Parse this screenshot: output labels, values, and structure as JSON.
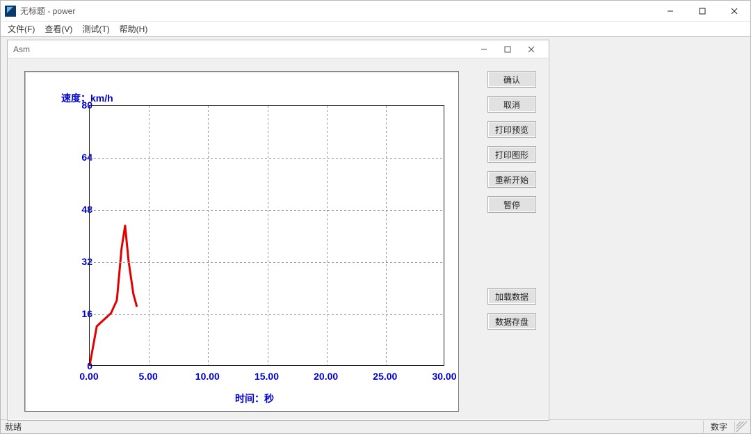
{
  "outer": {
    "title": "无标题 - power",
    "menu": {
      "file": "文件(F)",
      "view": "查看(V)",
      "test": "测试(T)",
      "help": "帮助(H)"
    }
  },
  "inner": {
    "title": "Asm"
  },
  "buttons": {
    "ok": "确认",
    "cancel": "取消",
    "print_preview": "打印预览",
    "print_graph": "打印图形",
    "restart": "重新开始",
    "pause": "暂停",
    "load_data": "加载数据",
    "save_data": "数据存盘"
  },
  "status": {
    "ready": "就绪",
    "num": "数字"
  },
  "chart_data": {
    "type": "line",
    "title": "",
    "ylabel": "速度：km/h",
    "xlabel": "时间：秒",
    "xlim": [
      0,
      30
    ],
    "ylim": [
      0,
      80
    ],
    "xticks": [
      0,
      5,
      10,
      15,
      20,
      25,
      30
    ],
    "xtick_labels": [
      "0.00",
      "5.00",
      "10.00",
      "15.00",
      "20.00",
      "25.00",
      "30.00"
    ],
    "yticks": [
      0,
      16,
      32,
      48,
      64,
      80
    ],
    "ytick_labels": [
      "0",
      "16",
      "32",
      "48",
      "64",
      "80"
    ],
    "series": [
      {
        "name": "speed",
        "color": "#e00000",
        "x": [
          0.0,
          0.6,
          1.2,
          1.8,
          2.3,
          2.7,
          3.0,
          3.3,
          3.7,
          4.0
        ],
        "values": [
          0,
          12,
          14,
          16,
          20,
          36,
          43,
          32,
          22,
          18
        ]
      }
    ]
  }
}
